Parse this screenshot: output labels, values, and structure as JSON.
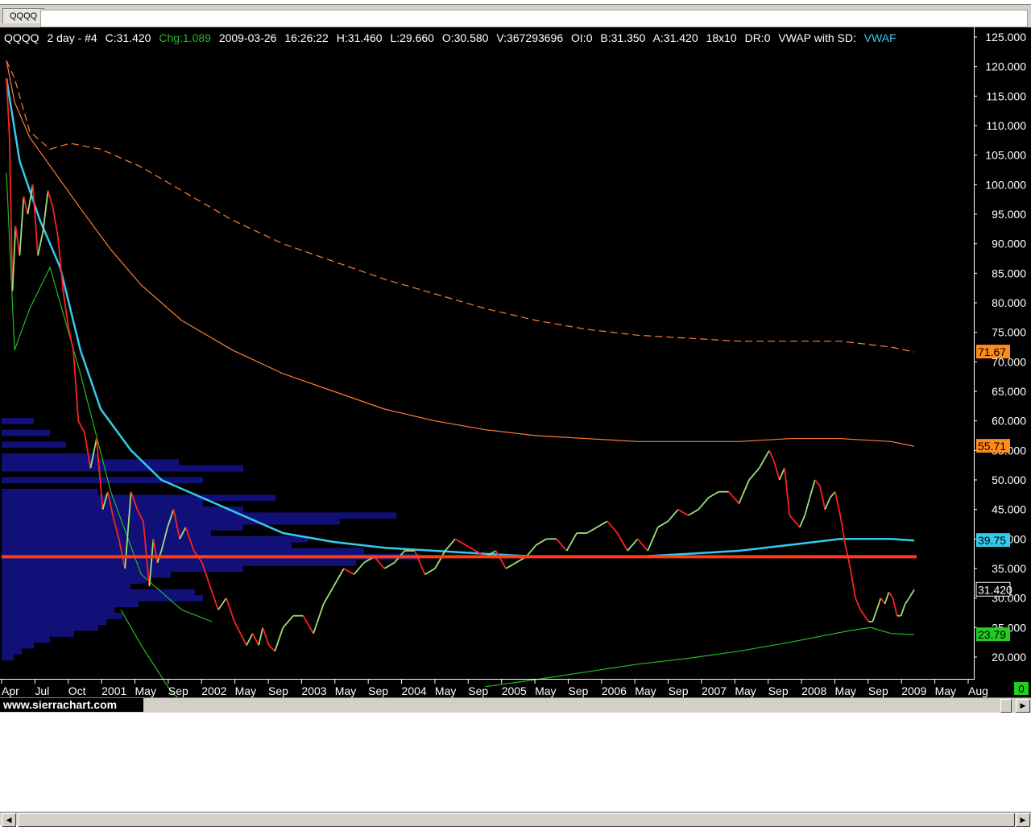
{
  "tab": {
    "label": "QQQQ"
  },
  "header": {
    "symbol": "QQQQ",
    "interval": "2 day - #4",
    "close": "C:31.420",
    "change": "Chg:1.089",
    "date": "2009-03-26",
    "time": "16:26:22",
    "high": "H:31.460",
    "low": "L:29.660",
    "open": "O:30.580",
    "volume": "V:367293696",
    "oi": "OI:0",
    "bid": "B:31.350",
    "ask": "A:31.420",
    "box": "18x10",
    "dr": "DR:0",
    "study": "VWAP with SD:",
    "study_tail": "VWAF"
  },
  "colors": {
    "background": "#000000",
    "price_up": "#9be07a",
    "price_down": "#ff2020",
    "vwap": "#33ccee",
    "band_upper": "#ff7f35",
    "band_lower": "#22bb22",
    "profile": "#101078",
    "poc_line": "#ff3c14",
    "axis_text": "#ffffff"
  },
  "footer": {
    "site": "www.sierrachart.com",
    "corner_value": "0"
  },
  "chart_data": {
    "type": "line",
    "title": "",
    "xlabel": "",
    "ylabel": "",
    "ylim": [
      15,
      125
    ],
    "grid": false,
    "y_ticks": [
      "125.000",
      "120.000",
      "115.000",
      "110.000",
      "105.000",
      "100.000",
      "95.000",
      "90.000",
      "85.000",
      "80.000",
      "75.000",
      "70.000",
      "65.000",
      "60.000",
      "55.000",
      "50.000",
      "45.000",
      "40.000",
      "35.000",
      "30.000",
      "25.000",
      "20.000"
    ],
    "x_tick_labels": [
      "Apr",
      "Jul",
      "Oct",
      "2001",
      "May",
      "Sep",
      "2002",
      "May",
      "Sep",
      "2003",
      "May",
      "Sep",
      "2004",
      "May",
      "Sep",
      "2005",
      "May",
      "Sep",
      "2006",
      "May",
      "Sep",
      "2007",
      "May",
      "Sep",
      "2008",
      "May",
      "Sep",
      "2009",
      "May",
      "Aug"
    ],
    "value_labels": [
      {
        "label": "71.67",
        "value": 71.67,
        "color": "#ff8c1a"
      },
      {
        "label": "55.71",
        "value": 55.71,
        "color": "#ff8c1a"
      },
      {
        "label": "39.75",
        "value": 39.75,
        "color": "#33ccee"
      },
      {
        "label": "31.420",
        "value": 31.42,
        "color": "#000000"
      },
      {
        "label": "23.79",
        "value": 23.79,
        "color": "#22cc22"
      }
    ],
    "poc_level": 37.0,
    "series": [
      {
        "name": "QQQQ",
        "x": [
          2000.27,
          2000.3,
          2000.33,
          2000.36,
          2000.4,
          2000.44,
          2000.48,
          2000.53,
          2000.58,
          2000.63,
          2000.68,
          2000.73,
          2000.78,
          2000.83,
          2000.88,
          2000.93,
          2000.98,
          2001.04,
          2001.1,
          2001.16,
          2001.22,
          2001.27,
          2001.32,
          2001.38,
          2001.44,
          2001.5,
          2001.56,
          2001.62,
          2001.68,
          2001.72,
          2001.76,
          2001.8,
          2001.86,
          2001.92,
          2001.98,
          2002.04,
          2002.12,
          2002.2,
          2002.28,
          2002.36,
          2002.44,
          2002.52,
          2002.58,
          2002.64,
          2002.7,
          2002.76,
          2002.8,
          2002.86,
          2002.92,
          2003.0,
          2003.1,
          2003.2,
          2003.3,
          2003.4,
          2003.5,
          2003.6,
          2003.7,
          2003.8,
          2003.9,
          2004.0,
          2004.1,
          2004.2,
          2004.3,
          2004.4,
          2004.5,
          2004.6,
          2004.7,
          2004.8,
          2004.9,
          2005.0,
          2005.1,
          2005.2,
          2005.3,
          2005.4,
          2005.5,
          2005.6,
          2005.7,
          2005.8,
          2005.9,
          2006.0,
          2006.1,
          2006.2,
          2006.3,
          2006.4,
          2006.5,
          2006.6,
          2006.7,
          2006.8,
          2006.9,
          2007.0,
          2007.1,
          2007.2,
          2007.3,
          2007.4,
          2007.5,
          2007.6,
          2007.7,
          2007.8,
          2007.85,
          2007.9,
          2007.95,
          2008.0,
          2008.05,
          2008.1,
          2008.15,
          2008.2,
          2008.25,
          2008.3,
          2008.35,
          2008.4,
          2008.45,
          2008.5,
          2008.55,
          2008.6,
          2008.65,
          2008.7,
          2008.74,
          2008.78,
          2008.82,
          2008.86,
          2008.9,
          2008.94,
          2008.98,
          2009.02,
          2009.06,
          2009.1,
          2009.14,
          2009.18,
          2009.23
        ],
        "y": [
          118,
          108,
          82,
          93,
          88,
          98,
          95,
          100,
          88,
          92,
          99,
          96,
          91,
          82,
          76,
          72,
          60,
          58,
          52,
          57,
          45,
          48,
          44,
          40,
          35,
          48,
          45,
          43,
          32,
          40,
          36,
          38,
          42,
          45,
          40,
          42,
          38,
          36,
          32,
          28,
          30,
          26,
          24,
          22,
          24,
          22,
          25,
          22,
          21,
          25,
          27,
          27,
          24,
          29,
          32,
          35,
          34,
          36,
          37,
          35,
          36,
          38,
          38,
          34,
          35,
          38,
          40,
          39,
          38,
          37,
          38,
          35,
          36,
          37,
          39,
          40,
          40,
          38,
          41,
          41,
          42,
          43,
          41,
          38,
          40,
          38,
          42,
          43,
          45,
          44,
          45,
          47,
          48,
          48,
          46,
          50,
          52,
          55,
          53,
          50,
          52,
          44,
          43,
          42,
          44,
          47,
          50,
          49,
          45,
          47,
          48,
          44,
          39,
          35,
          30,
          28,
          27,
          26,
          26,
          28,
          30,
          29,
          31,
          30,
          27,
          27,
          29,
          30,
          31.42
        ]
      },
      {
        "name": "",
        "x": [
          2000.27,
          2000.4,
          2000.6,
          2000.8,
          2001.0,
          2001.2,
          2001.5,
          2001.8,
          2002.2,
          2002.6,
          2003.0,
          2003.5,
          2004.0,
          2004.5,
          2005.0,
          2005.5,
          2006.0,
          2006.5,
          2007.0,
          2007.5,
          2008.0,
          2008.5,
          2009.0,
          2009.23
        ],
        "y": [
          118,
          104,
          94,
          86,
          72,
          62,
          55,
          50,
          47,
          44,
          41,
          39.5,
          38.5,
          38,
          37.5,
          37,
          37,
          37,
          37.5,
          38,
          39,
          40,
          40,
          39.75
        ]
      },
      {
        "name": "",
        "x": [
          2000.27,
          2000.35,
          2000.5,
          2000.75,
          2001.0,
          2001.3,
          2001.6,
          2002.0,
          2002.5,
          2003.0,
          2003.5,
          2004.0,
          2004.5,
          2005.0,
          2005.5,
          2006.0,
          2006.5,
          2007.0,
          2007.5,
          2008.0,
          2008.5,
          2009.0,
          2009.23
        ],
        "y": [
          121,
          114,
          108,
          102,
          96,
          89,
          83,
          77,
          72,
          68,
          65,
          62,
          60,
          58.5,
          57.5,
          57,
          56.5,
          56.5,
          56.5,
          57,
          57,
          56.5,
          55.71
        ]
      },
      {
        "name": "",
        "x": [
          2000.27,
          2000.35,
          2000.5,
          2000.7,
          2000.9,
          2001.2,
          2001.6,
          2002.0,
          2002.5,
          2003.0,
          2003.5,
          2004.0,
          2004.5,
          2005.0,
          2005.5,
          2006.0,
          2006.5,
          2007.0,
          2007.5,
          2008.0,
          2008.5,
          2009.0,
          2009.23
        ],
        "y": [
          121,
          118,
          109,
          106,
          107,
          106,
          103,
          99,
          94,
          90,
          87,
          84,
          81.5,
          79,
          77,
          75.5,
          74.5,
          74,
          73.5,
          73.5,
          73.5,
          72.5,
          71.67
        ]
      },
      {
        "name": "",
        "x": [
          2000.27,
          2000.35,
          2000.5,
          2000.7,
          2001.0,
          2001.3,
          2001.6,
          2002.0,
          2002.3
        ],
        "y": [
          102,
          72,
          79,
          86,
          68,
          48,
          34,
          28,
          26
        ]
      },
      {
        "name": "",
        "x": [
          2001.4,
          2001.6,
          2001.9,
          2002.2,
          2002.5,
          2002.8
        ],
        "y": [
          28,
          22,
          14,
          10,
          8,
          6
        ]
      },
      {
        "name": "",
        "x": [
          2005.0,
          2005.5,
          2006.0,
          2006.5,
          2007.0,
          2007.5,
          2008.0,
          2008.3,
          2008.6,
          2008.8,
          2009.0,
          2009.23
        ],
        "y": [
          15,
          16.2,
          17.5,
          18.8,
          19.8,
          21,
          22.5,
          23.5,
          24.5,
          25,
          24,
          23.79
        ]
      }
    ]
  }
}
